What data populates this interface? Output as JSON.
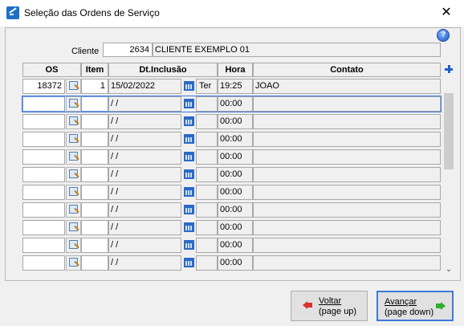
{
  "window": {
    "title": "Seleção das Ordens de Serviço",
    "close_glyph": "✕",
    "help_glyph": "?"
  },
  "client": {
    "label": "Cliente",
    "code": "2634",
    "name": "CLIENTE EXEMPLO 01"
  },
  "table": {
    "headers": {
      "os": "OS",
      "item": "Item",
      "date": "Dt.Inclusão",
      "hora": "Hora",
      "contato": "Contato"
    },
    "rows": [
      {
        "os": "18372",
        "item": "1",
        "date": "15/02/2022",
        "dow": "Ter",
        "hora": "19:25",
        "contato": "JOAO"
      },
      {
        "os": "",
        "item": "",
        "date": " / /",
        "dow": "",
        "hora": "00:00",
        "contato": ""
      },
      {
        "os": "",
        "item": "",
        "date": " / /",
        "dow": "",
        "hora": "00:00",
        "contato": ""
      },
      {
        "os": "",
        "item": "",
        "date": " / /",
        "dow": "",
        "hora": "00:00",
        "contato": ""
      },
      {
        "os": "",
        "item": "",
        "date": " / /",
        "dow": "",
        "hora": "00:00",
        "contato": ""
      },
      {
        "os": "",
        "item": "",
        "date": " / /",
        "dow": "",
        "hora": "00:00",
        "contato": ""
      },
      {
        "os": "",
        "item": "",
        "date": " / /",
        "dow": "",
        "hora": "00:00",
        "contato": ""
      },
      {
        "os": "",
        "item": "",
        "date": " / /",
        "dow": "",
        "hora": "00:00",
        "contato": ""
      },
      {
        "os": "",
        "item": "",
        "date": " / /",
        "dow": "",
        "hora": "00:00",
        "contato": ""
      },
      {
        "os": "",
        "item": "",
        "date": " / /",
        "dow": "",
        "hora": "00:00",
        "contato": ""
      },
      {
        "os": "",
        "item": "",
        "date": " / /",
        "dow": "",
        "hora": "00:00",
        "contato": ""
      }
    ]
  },
  "buttons": {
    "back": {
      "line1": "Voltar",
      "line2": "(page up)"
    },
    "next": {
      "line1": "Avançar",
      "line2": "(page down)"
    }
  },
  "scroll": {
    "down_glyph": "⌄"
  }
}
